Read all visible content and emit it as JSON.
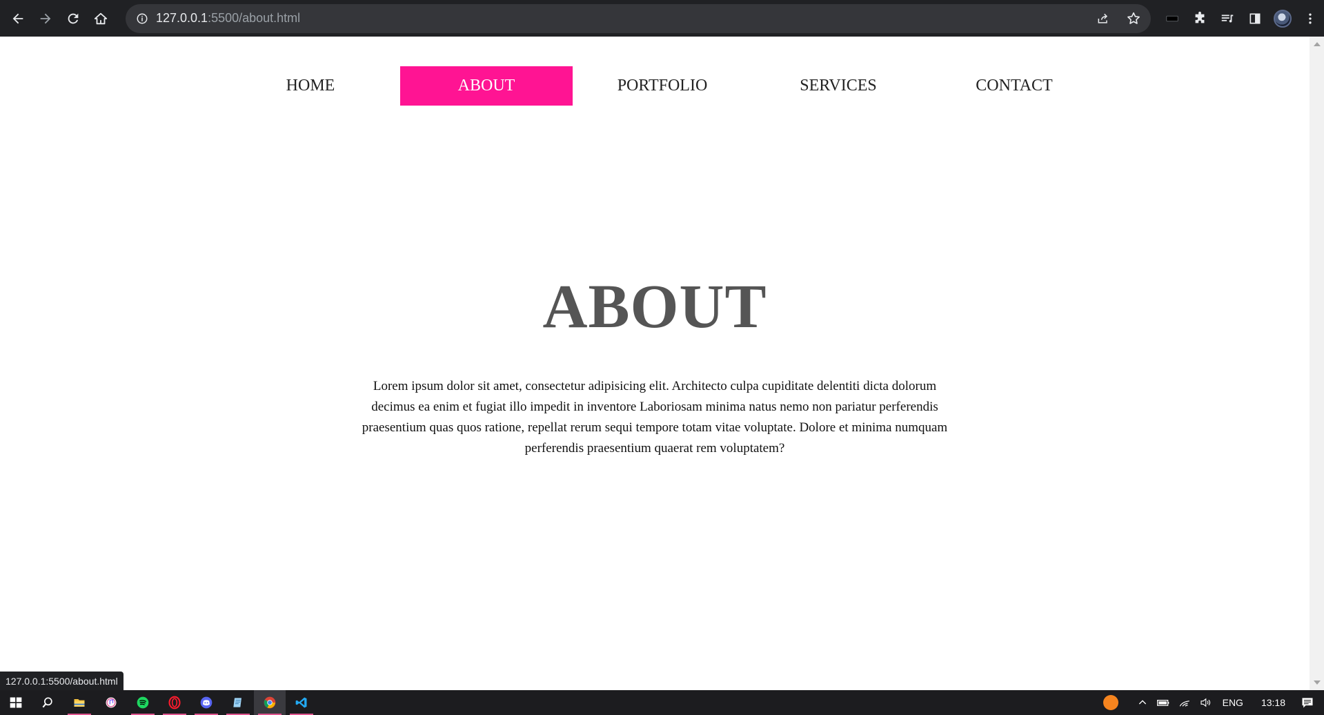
{
  "browser": {
    "url_host": "127.0.0.1",
    "url_path": ":5500/about.html",
    "icons": [
      "back-icon",
      "forward-icon",
      "reload-icon",
      "home-icon",
      "info-icon",
      "share-icon",
      "star-icon",
      "extension-icon",
      "puzzle-icon",
      "media-icon",
      "sidepanel-icon",
      "avatar",
      "menu-icon"
    ]
  },
  "nav": {
    "items": [
      {
        "label": "HOME"
      },
      {
        "label": "ABOUT"
      },
      {
        "label": "PORTFOLIO"
      },
      {
        "label": "SERVICES"
      },
      {
        "label": "CONTACT"
      }
    ],
    "active_index": 1,
    "accent_color": "#ff1493"
  },
  "main": {
    "title": "ABOUT",
    "paragraph": "Lorem ipsum dolor sit amet, consectetur adipisicing elit. Architecto culpa cupiditate delentiti dicta dolorum decimus ea enim et fugiat illo impedit in inventore Laboriosam minima natus nemo non pariatur perferendis praesentium quas quos ratione, repellat rerum sequi tempore totam vitae voluptate. Dolore et minima numquam perferendis praesentium quaerat rem voluptatem?"
  },
  "status_bar": {
    "text": "127.0.0.1:5500/about.html"
  },
  "taskbar": {
    "apps": [
      "windows-icon",
      "search-icon",
      "file-explorer-icon",
      "itunes-icon",
      "spotify-icon",
      "opera-icon",
      "discord-icon",
      "notepad-icon",
      "chrome-icon",
      "vscode-icon"
    ],
    "language": "ENG",
    "time": "13:18"
  }
}
